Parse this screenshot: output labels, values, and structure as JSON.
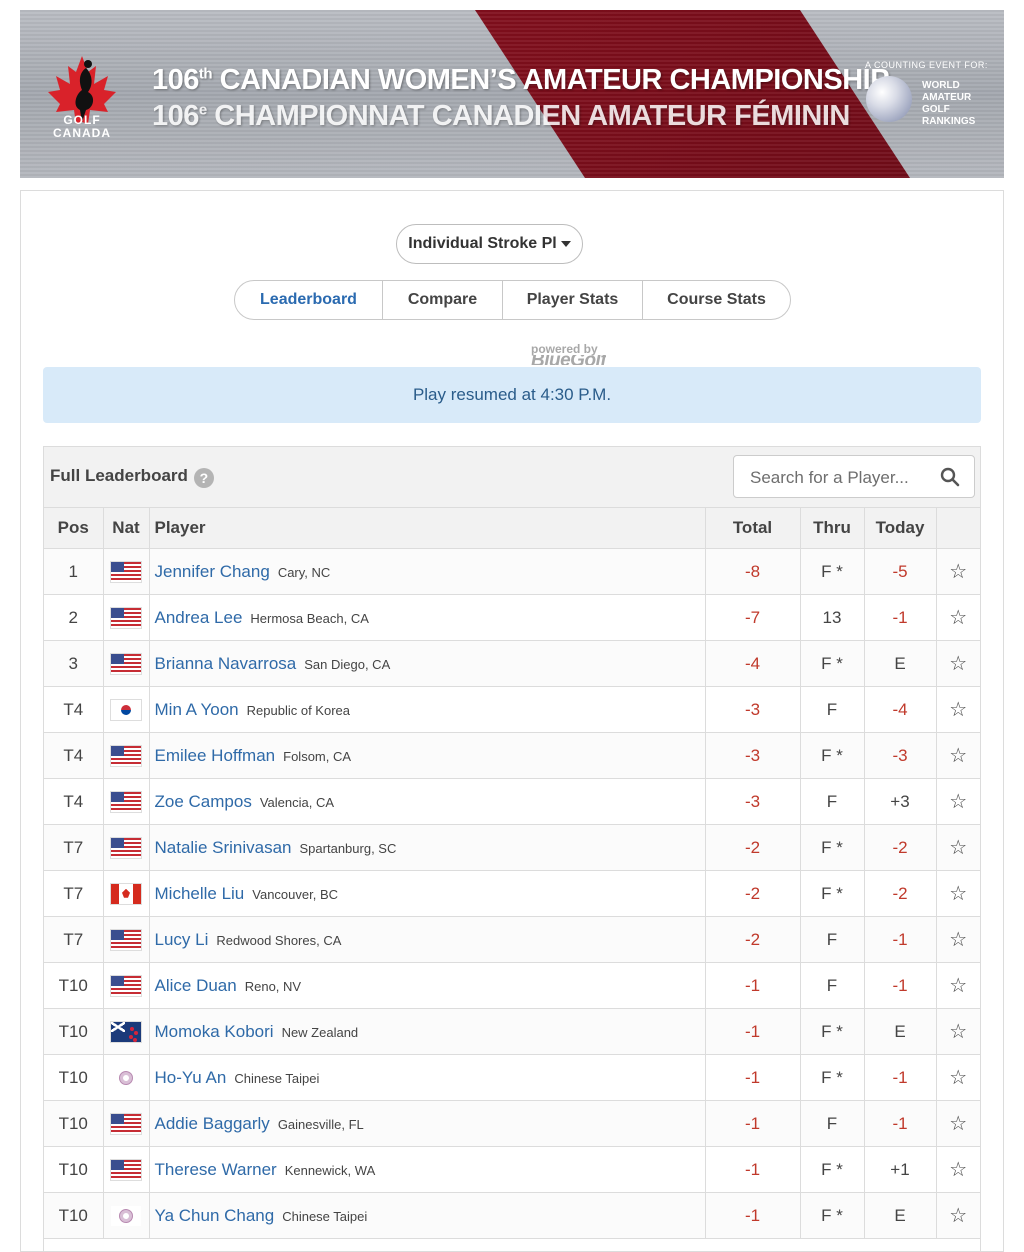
{
  "banner": {
    "logo_text_line1": "GOLF",
    "logo_text_line2": "CANADA",
    "title_en_num": "106",
    "title_en_sup": "th",
    "title_en_rest": "CANADIAN WOMEN’S AMATEUR CHAMPIONSHIP",
    "title_fr_num": "106",
    "title_fr_sup": "e",
    "title_fr_rest": "CHAMPIONNAT CANADIEN AMATEUR FÉMININ",
    "wagr_caption": "A COUNTING EVENT FOR:",
    "wagr_line1": "WORLD",
    "wagr_line2": "AMATEUR",
    "wagr_line3": "GOLF",
    "wagr_line4": "RANKINGS",
    "colors": {
      "red": "#8e1020",
      "silver": "#a8abb2"
    }
  },
  "controls": {
    "dropdown_label": "Individual Stroke Pl",
    "tabs": [
      {
        "label": "Leaderboard",
        "active": true
      },
      {
        "label": "Compare",
        "active": false
      },
      {
        "label": "Player Stats",
        "active": false
      },
      {
        "label": "Course Stats",
        "active": false
      }
    ],
    "powered_line1": "powered by",
    "powered_line2": "BlueGolf"
  },
  "notice": "Play resumed at 4:30 P.M.",
  "leaderboard": {
    "title": "Full Leaderboard",
    "help_icon": "question-circle-icon",
    "search_placeholder": "Search for a Player...",
    "columns": {
      "pos": "Pos",
      "nat": "Nat",
      "player": "Player",
      "total": "Total",
      "thru": "Thru",
      "today": "Today"
    },
    "rows": [
      {
        "pos": "1",
        "nat": "us",
        "name": "Jennifer Chang",
        "loc": "Cary, NC",
        "total": "-8",
        "thru": "F *",
        "today": "-5"
      },
      {
        "pos": "2",
        "nat": "us",
        "name": "Andrea Lee",
        "loc": "Hermosa Beach, CA",
        "total": "-7",
        "thru": "13",
        "today": "-1"
      },
      {
        "pos": "3",
        "nat": "us",
        "name": "Brianna Navarrosa",
        "loc": "San Diego, CA",
        "total": "-4",
        "thru": "F *",
        "today": "E"
      },
      {
        "pos": "T4",
        "nat": "kr",
        "name": "Min A Yoon",
        "loc": "Republic of Korea",
        "total": "-3",
        "thru": "F",
        "today": "-4"
      },
      {
        "pos": "T4",
        "nat": "us",
        "name": "Emilee Hoffman",
        "loc": "Folsom, CA",
        "total": "-3",
        "thru": "F *",
        "today": "-3"
      },
      {
        "pos": "T4",
        "nat": "us",
        "name": "Zoe Campos",
        "loc": "Valencia, CA",
        "total": "-3",
        "thru": "F",
        "today": "+3"
      },
      {
        "pos": "T7",
        "nat": "us",
        "name": "Natalie Srinivasan",
        "loc": "Spartanburg, SC",
        "total": "-2",
        "thru": "F *",
        "today": "-2"
      },
      {
        "pos": "T7",
        "nat": "ca",
        "name": "Michelle Liu",
        "loc": "Vancouver, BC",
        "total": "-2",
        "thru": "F *",
        "today": "-2"
      },
      {
        "pos": "T7",
        "nat": "us",
        "name": "Lucy Li",
        "loc": "Redwood Shores, CA",
        "total": "-2",
        "thru": "F",
        "today": "-1"
      },
      {
        "pos": "T10",
        "nat": "us",
        "name": "Alice Duan",
        "loc": "Reno, NV",
        "total": "-1",
        "thru": "F",
        "today": "-1"
      },
      {
        "pos": "T10",
        "nat": "nz",
        "name": "Momoka Kobori",
        "loc": "New Zealand",
        "total": "-1",
        "thru": "F *",
        "today": "E"
      },
      {
        "pos": "T10",
        "nat": "tpe",
        "name": "Ho-Yu An",
        "loc": "Chinese Taipei",
        "total": "-1",
        "thru": "F *",
        "today": "-1"
      },
      {
        "pos": "T10",
        "nat": "us",
        "name": "Addie Baggarly",
        "loc": "Gainesville, FL",
        "total": "-1",
        "thru": "F",
        "today": "-1"
      },
      {
        "pos": "T10",
        "nat": "us",
        "name": "Therese Warner",
        "loc": "Kennewick, WA",
        "total": "-1",
        "thru": "F *",
        "today": "+1"
      },
      {
        "pos": "T10",
        "nat": "tpe",
        "name": "Ya Chun Chang",
        "loc": "Chinese Taipei",
        "total": "-1",
        "thru": "F *",
        "today": "E"
      }
    ],
    "star_icon": "star-outline-icon",
    "colors": {
      "player_link": "#2f6aa8",
      "negative": "#c0392b"
    }
  }
}
